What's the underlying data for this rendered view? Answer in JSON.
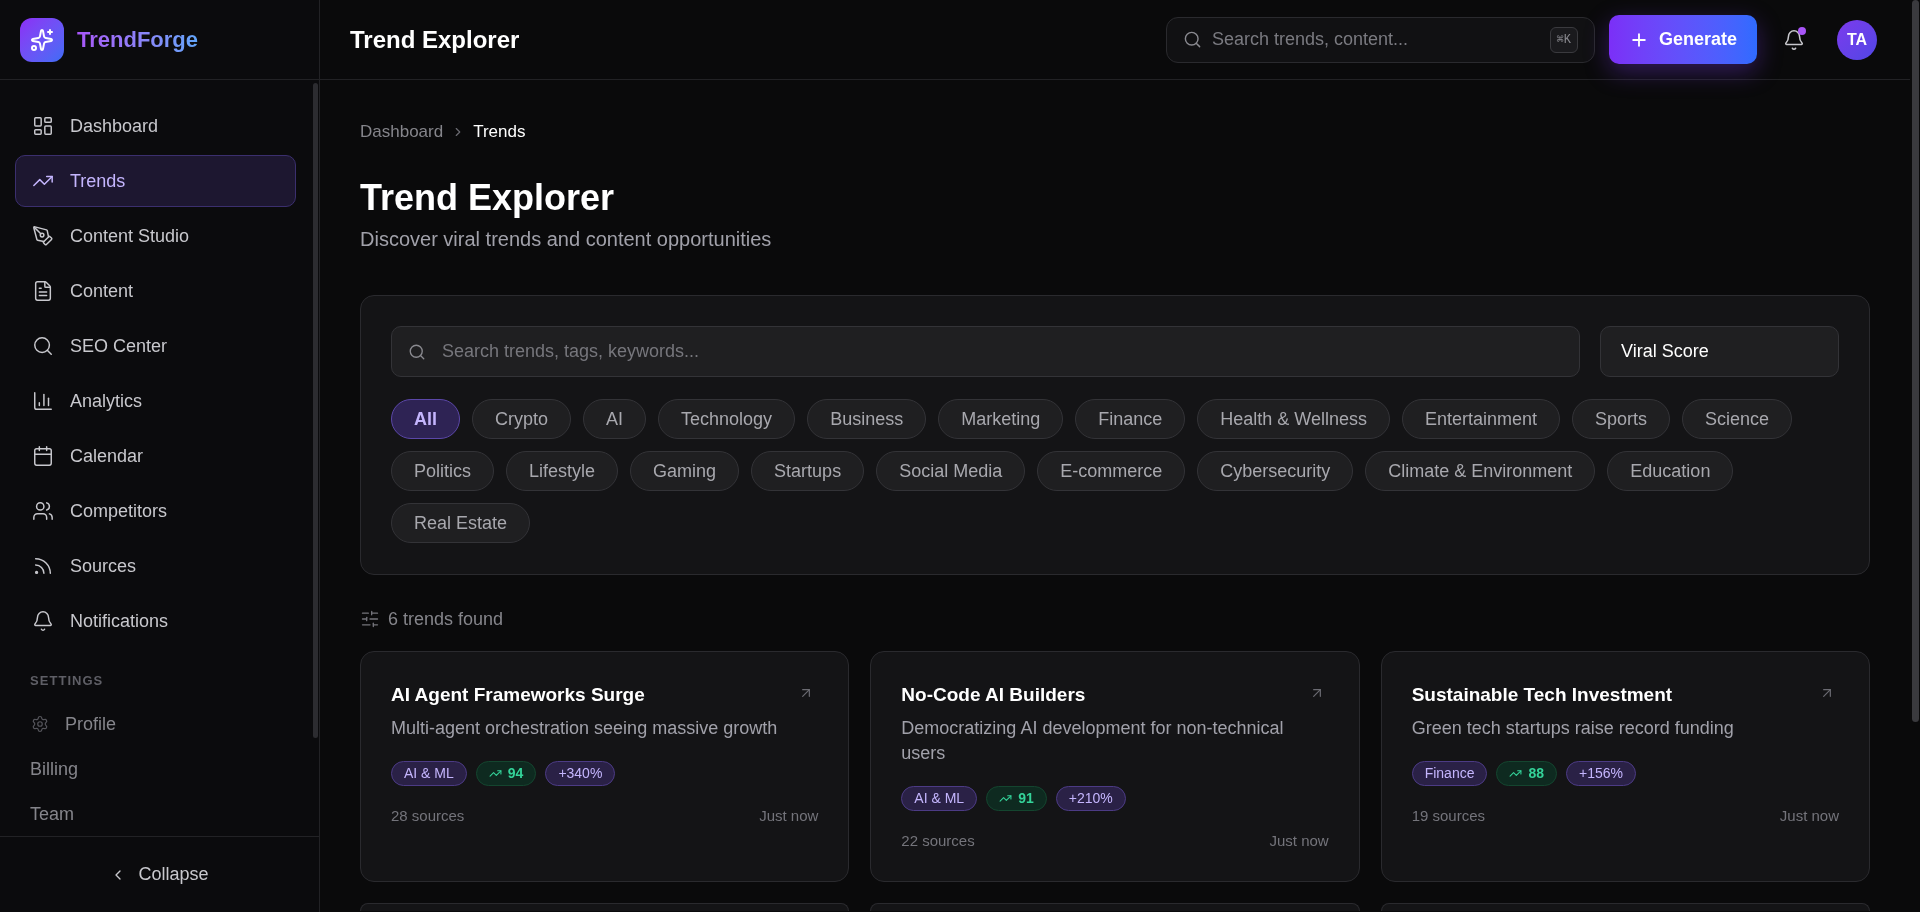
{
  "sidebar": {
    "brand": "TrendForge",
    "nav": [
      {
        "label": "Dashboard",
        "selected": false
      },
      {
        "label": "Trends",
        "selected": true
      },
      {
        "label": "Content Studio",
        "selected": false
      },
      {
        "label": "Content",
        "selected": false
      },
      {
        "label": "SEO Center",
        "selected": false
      },
      {
        "label": "Analytics",
        "selected": false
      },
      {
        "label": "Calendar",
        "selected": false
      },
      {
        "label": "Competitors",
        "selected": false
      },
      {
        "label": "Sources",
        "selected": false
      },
      {
        "label": "Notifications",
        "selected": false
      }
    ],
    "settings": {
      "heading": "SETTINGS",
      "items": [
        {
          "label": "Profile"
        },
        {
          "label": "Billing"
        },
        {
          "label": "Team"
        }
      ]
    },
    "collapse_button": {
      "label": "Collapse"
    }
  },
  "header": {
    "title": "Trend Explorer",
    "search": {
      "placeholder": "Search trends, content...",
      "shortcut": "⌘K"
    },
    "generate_button": {
      "label": "Generate"
    },
    "notifications": {
      "unread": true
    },
    "avatar": {
      "initials": "TA"
    }
  },
  "breadcrumb": [
    {
      "label": "Dashboard",
      "current": false
    },
    {
      "label": "Trends",
      "current": true
    }
  ],
  "page": {
    "title": "Trend Explorer",
    "subtitle": "Discover viral trends and content opportunities"
  },
  "filters": {
    "search": {
      "placeholder": "Search trends, tags, keywords..."
    },
    "sort": {
      "value": "Viral Score"
    },
    "categories": [
      {
        "label": "All",
        "selected": true
      },
      {
        "label": "Crypto",
        "selected": false
      },
      {
        "label": "AI",
        "selected": false
      },
      {
        "label": "Technology",
        "selected": false
      },
      {
        "label": "Business",
        "selected": false
      },
      {
        "label": "Marketing",
        "selected": false
      },
      {
        "label": "Finance",
        "selected": false
      },
      {
        "label": "Health & Wellness",
        "selected": false
      },
      {
        "label": "Entertainment",
        "selected": false
      },
      {
        "label": "Sports",
        "selected": false
      },
      {
        "label": "Science",
        "selected": false
      },
      {
        "label": "Politics",
        "selected": false
      },
      {
        "label": "Lifestyle",
        "selected": false
      },
      {
        "label": "Gaming",
        "selected": false
      },
      {
        "label": "Startups",
        "selected": false
      },
      {
        "label": "Social Media",
        "selected": false
      },
      {
        "label": "E-commerce",
        "selected": false
      },
      {
        "label": "Cybersecurity",
        "selected": false
      },
      {
        "label": "Climate & Environment",
        "selected": false
      },
      {
        "label": "Education",
        "selected": false
      },
      {
        "label": "Real Estate",
        "selected": false
      }
    ]
  },
  "results": {
    "count": "6 trends found"
  },
  "cards": [
    {
      "kind": "trend",
      "title": "AI Agent Frameworks Surge",
      "description": "Multi-agent orchestration seeing massive growth",
      "category": "AI & ML",
      "score": "94",
      "growth": "+340%",
      "sources": "28 sources",
      "time": "Just now"
    },
    {
      "kind": "trend",
      "title": "No-Code AI Builders",
      "description": "Democratizing AI development for non-technical users",
      "category": "AI & ML",
      "score": "91",
      "growth": "+210%",
      "sources": "22 sources",
      "time": "Just now"
    },
    {
      "kind": "trend",
      "title": "Sustainable Tech Investment",
      "description": "Green tech startups raise record funding",
      "category": "Finance",
      "score": "88",
      "growth": "+156%",
      "sources": "19 sources",
      "time": "Just now"
    },
    {
      "kind": "cut_off"
    },
    {
      "kind": "cut_off"
    },
    {
      "kind": "cut_off"
    }
  ]
}
